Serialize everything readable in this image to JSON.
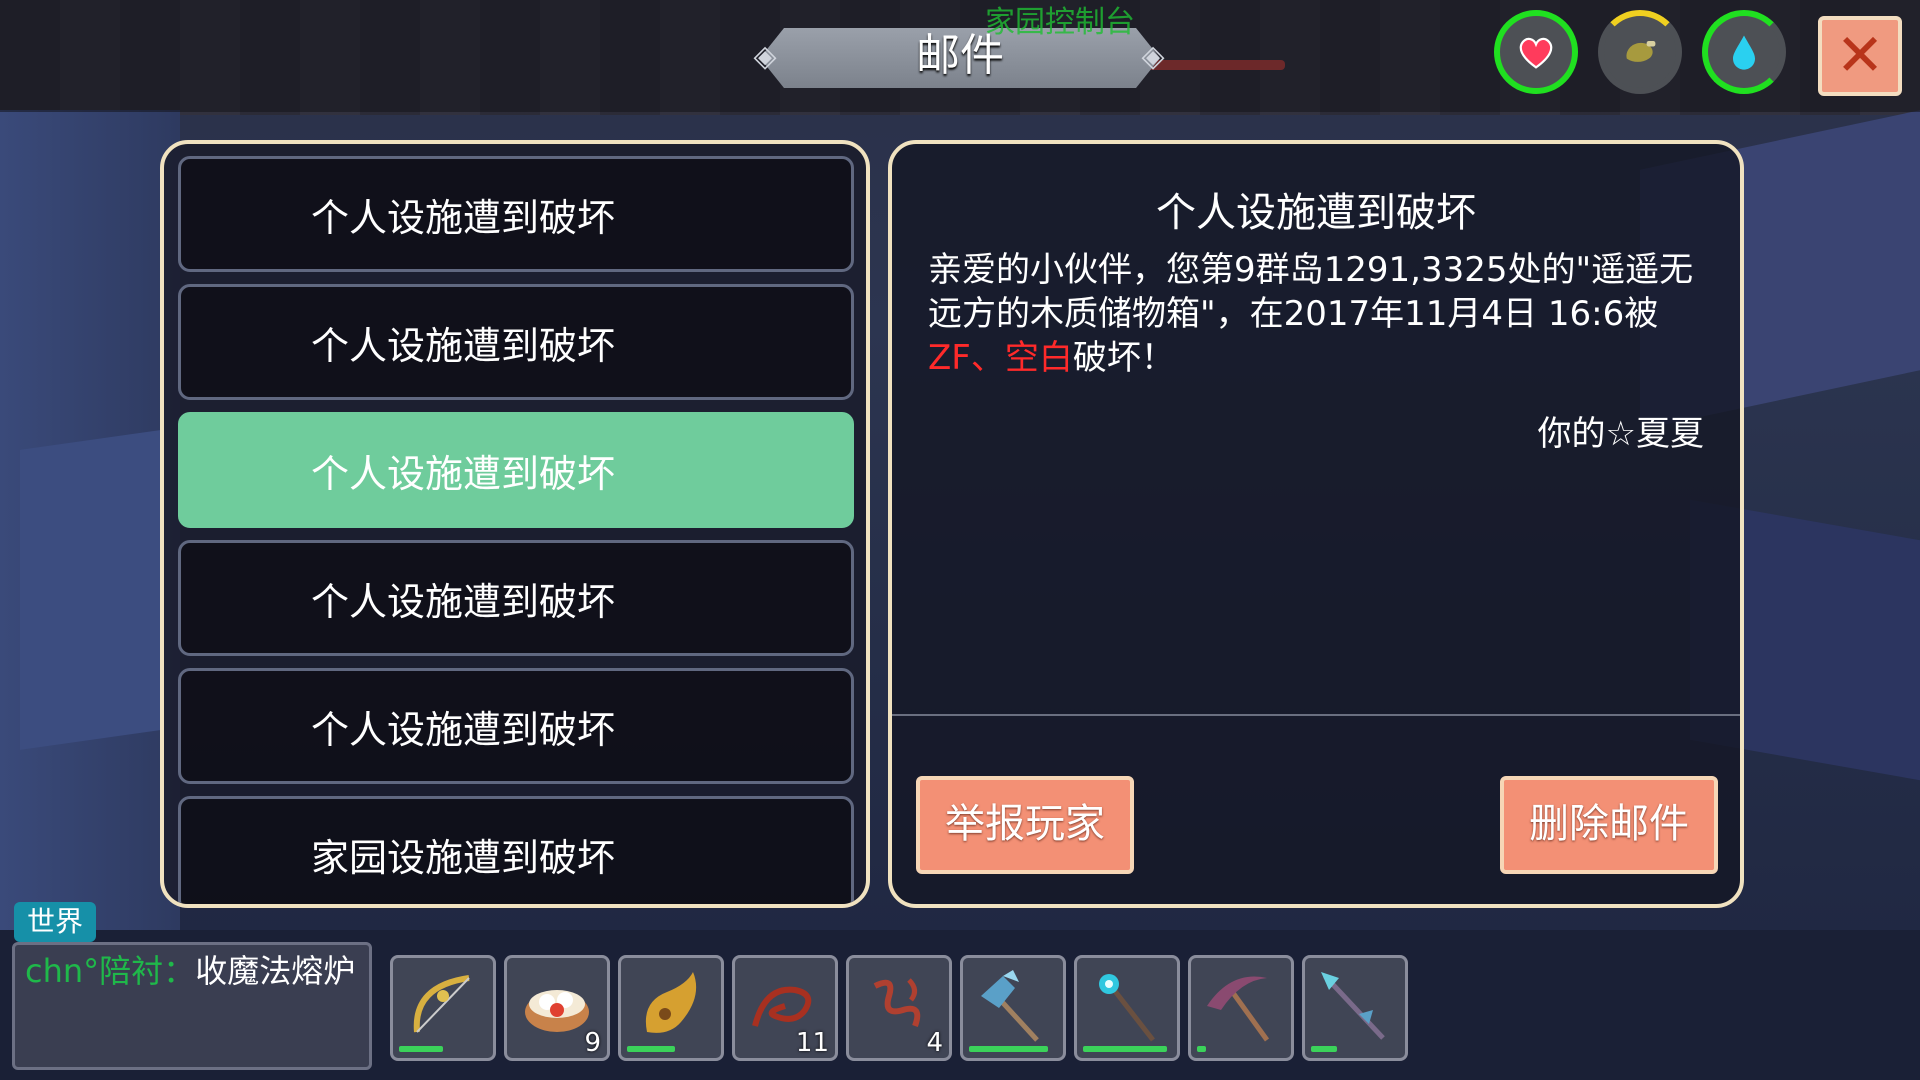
{
  "header": {
    "title": "邮件",
    "subtitle": "家园控制台"
  },
  "stats": [
    {
      "name": "health",
      "icon": "heart-icon",
      "color": "#ff3b5c"
    },
    {
      "name": "hunger",
      "icon": "drumstick-icon",
      "color": "#a79a3e"
    },
    {
      "name": "water",
      "icon": "water-drop-icon",
      "color": "#2ad0f0"
    }
  ],
  "close_label": "✕",
  "mail_list": [
    {
      "label": "个人设施遭到破坏",
      "selected": false
    },
    {
      "label": "个人设施遭到破坏",
      "selected": false
    },
    {
      "label": "个人设施遭到破坏",
      "selected": true
    },
    {
      "label": "个人设施遭到破坏",
      "selected": false
    },
    {
      "label": "个人设施遭到破坏",
      "selected": false
    },
    {
      "label": "家园设施遭到破坏",
      "selected": false
    }
  ],
  "mail_detail": {
    "title": "个人设施遭到破坏",
    "body_prefix": "亲爱的小伙伴，您第9群岛1291,3325处的\"遥遥无远方的木质储物箱\"，在2017年11月4日 16:6被",
    "attacker_1": "ZF",
    "separator": "、",
    "attacker_2": "空白",
    "body_suffix": "破坏！",
    "signature": "你的☆夏夏"
  },
  "buttons": {
    "report": "举报玩家",
    "delete": "删除邮件"
  },
  "chat": {
    "tab": "世界",
    "sender": "chn°陪衬",
    "separator": "：",
    "message": "收魔法熔炉"
  },
  "hotbar": [
    {
      "icon": "bow-icon",
      "count": "",
      "durability": 0.5
    },
    {
      "icon": "dumpling-steamer-icon",
      "count": "9",
      "durability": null
    },
    {
      "icon": "horn-icon",
      "count": "",
      "durability": 0.55
    },
    {
      "icon": "red-whip-icon",
      "count": "11",
      "durability": null
    },
    {
      "icon": "red-vine-icon",
      "count": "4",
      "durability": null
    },
    {
      "icon": "crystal-axe-icon",
      "count": "",
      "durability": 0.9
    },
    {
      "icon": "crystal-staff-icon",
      "count": "",
      "durability": 0.95
    },
    {
      "icon": "pickaxe-icon",
      "count": "",
      "durability": 0.1
    },
    {
      "icon": "crystal-spear-icon",
      "count": "",
      "durability": 0.3
    }
  ]
}
